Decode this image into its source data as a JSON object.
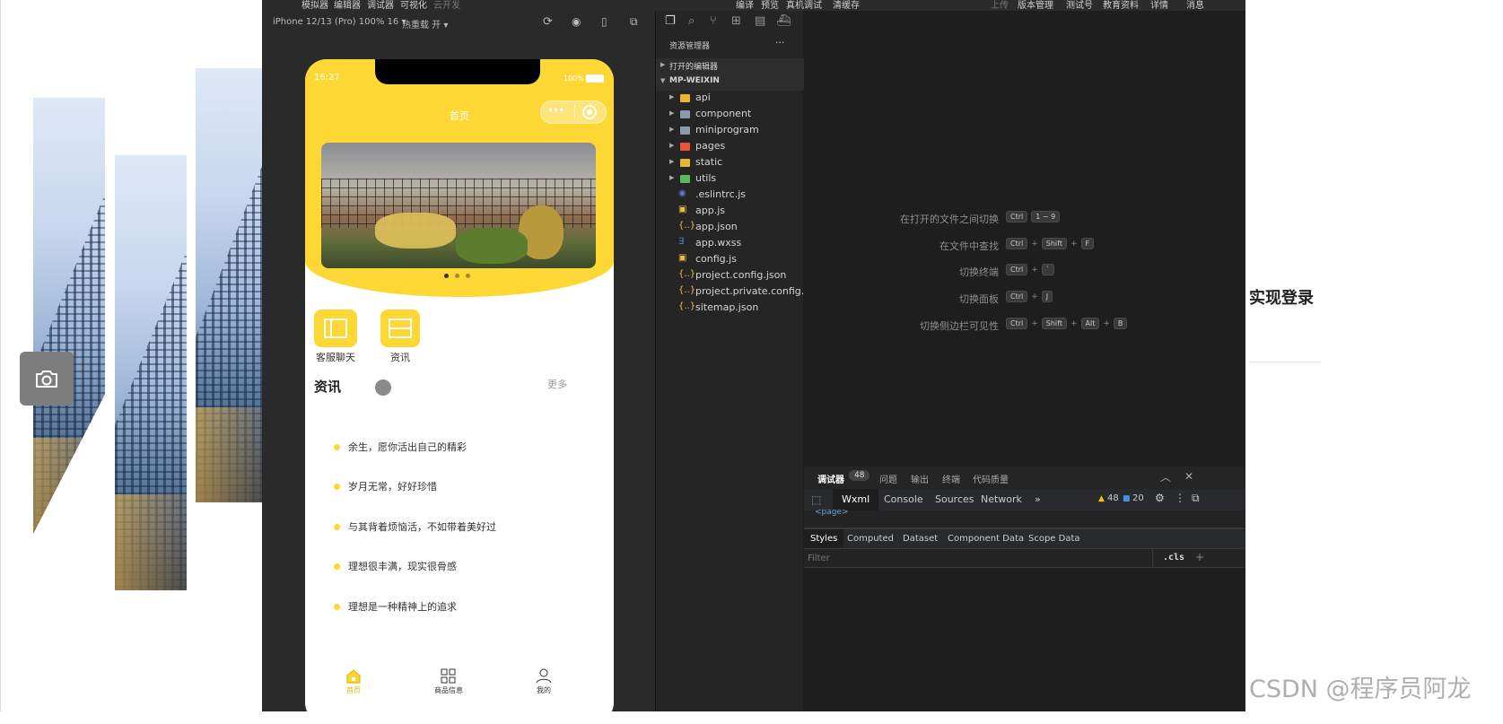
{
  "menu_bar": {
    "left_items": [
      "模拟器",
      "编辑器",
      "调试器",
      "可视化",
      "云开发"
    ],
    "center_items": [
      "编译",
      "预览",
      "真机调试",
      "清缓存"
    ],
    "right_items": [
      "上传",
      "版本管理",
      "测试号",
      "教育资料",
      "详情",
      "消息"
    ]
  },
  "simulator": {
    "device": "iPhone 12/13 (Pro) 100% 16 ▾",
    "hot_reload": "热重载 开 ▾",
    "status_time": "16:27",
    "status_battery": "100%",
    "nav_title": "首页",
    "quick_links": [
      "客服聊天",
      "资讯"
    ],
    "news_title": "资讯",
    "news_more": "更多",
    "news_items": [
      "余生，愿你活出自己的精彩",
      "岁月无常，好好珍惜",
      "与其背着烦恼活，不如带着美好过",
      "理想很丰满，现实很骨感",
      "理想是一种精神上的追求"
    ],
    "tabs": [
      "首页",
      "商品信息",
      "我的"
    ]
  },
  "explorer": {
    "title": "资源管理器",
    "more": "···",
    "open_editors": "打开的编辑器",
    "project": "MP-WEIXIN",
    "items": [
      {
        "name": "api",
        "kind": "folder",
        "color": "#e8b630"
      },
      {
        "name": "component",
        "kind": "folder",
        "color": "#8a9aa8"
      },
      {
        "name": "miniprogram",
        "kind": "folder",
        "color": "#8a9aa8"
      },
      {
        "name": "pages",
        "kind": "folder",
        "color": "#e8553a"
      },
      {
        "name": "static",
        "kind": "folder",
        "color": "#e8b630"
      },
      {
        "name": "utils",
        "kind": "folder",
        "color": "#5cb85c"
      },
      {
        "name": ".eslintrc.js",
        "kind": "file",
        "icon": "◉",
        "color": "#6a6fd8"
      },
      {
        "name": "app.js",
        "kind": "file",
        "icon": "▣",
        "color": "#e8c23a"
      },
      {
        "name": "app.json",
        "kind": "file",
        "icon": "{..}",
        "color": "#e8c23a"
      },
      {
        "name": "app.wxss",
        "kind": "file",
        "icon": "∃",
        "color": "#4a8ee0"
      },
      {
        "name": "config.js",
        "kind": "file",
        "icon": "▣",
        "color": "#e8c23a"
      },
      {
        "name": "project.config.json",
        "kind": "file",
        "icon": "{..}",
        "color": "#e8c23a"
      },
      {
        "name": "project.private.config.js...",
        "kind": "file",
        "icon": "{..}",
        "color": "#e8c23a"
      },
      {
        "name": "sitemap.json",
        "kind": "file",
        "icon": "{..}",
        "color": "#e8c23a"
      }
    ]
  },
  "shortcuts": [
    {
      "label": "在打开的文件之间切换",
      "keys": [
        "Ctrl",
        "1 ~ 9"
      ]
    },
    {
      "label": "在文件中查找",
      "keys": [
        "Ctrl",
        "+",
        "Shift",
        "+",
        "F"
      ]
    },
    {
      "label": "切换终端",
      "keys": [
        "Ctrl",
        "+",
        "`"
      ]
    },
    {
      "label": "切换面板",
      "keys": [
        "Ctrl",
        "+",
        "J"
      ]
    },
    {
      "label": "切换侧边栏可见性",
      "keys": [
        "Ctrl",
        "+",
        "Shift",
        "+",
        "Alt",
        "+",
        "B"
      ]
    }
  ],
  "debugger": {
    "panel_tabs": [
      "调试器",
      "问题",
      "输出",
      "终端",
      "代码质量"
    ],
    "badge": "48",
    "dev_tabs": [
      "Wxml",
      "Console",
      "Sources",
      "Network",
      "»"
    ],
    "warnings": "48",
    "messages": "20",
    "dom_snippet": "<page>",
    "style_tabs": [
      "Styles",
      "Computed",
      "Dataset",
      "Component Data",
      "Scope Data"
    ],
    "filter_placeholder": "Filter",
    "cls": ".cls",
    "plus": "+"
  },
  "page": {
    "heading": "实现登录",
    "watermark": "CSDN @程序员阿龙"
  }
}
